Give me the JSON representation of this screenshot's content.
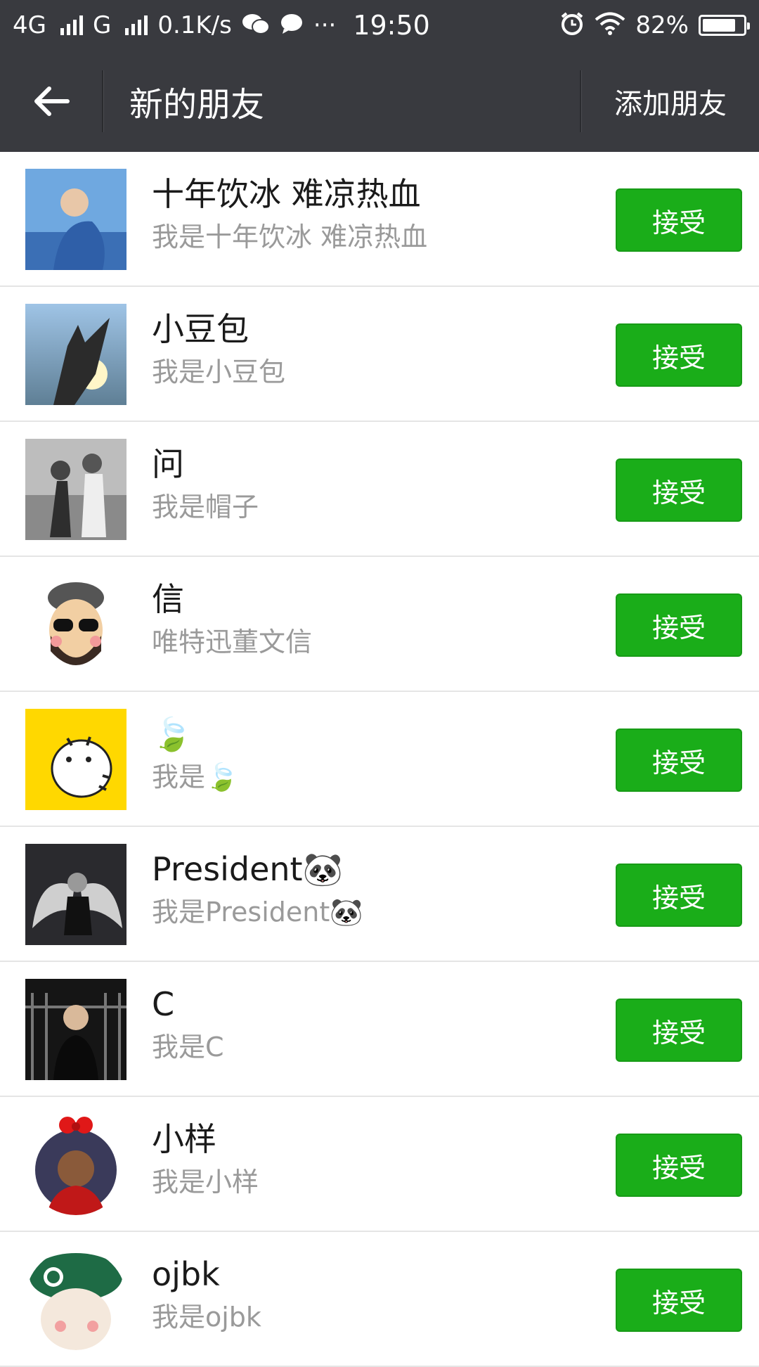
{
  "status_bar": {
    "network_1": "4G",
    "network_2": "G",
    "speed": "0.1K/s",
    "extra_icons": "···",
    "time": "19:50",
    "battery": "82%",
    "battery_level": 0.82
  },
  "header": {
    "back_icon": "arrow-left-icon",
    "title": "新的朋友",
    "add_friend_label": "添加朋友"
  },
  "accept_color": "#1aad19",
  "requests": [
    {
      "name": "十年饮冰 难凉热血",
      "message": "我是十年饮冰 难凉热血",
      "accept_label": "接受"
    },
    {
      "name": "小豆包",
      "message": "我是小豆包",
      "accept_label": "接受"
    },
    {
      "name": "问",
      "message": "我是帽子",
      "accept_label": "接受"
    },
    {
      "name": "信",
      "message": "唯特迅董文信",
      "accept_label": "接受"
    },
    {
      "name": "🍃",
      "message": "我是🍃",
      "accept_label": "接受"
    },
    {
      "name": "President🐼",
      "message": "我是President🐼",
      "accept_label": "接受"
    },
    {
      "name": "C",
      "message": "我是C",
      "accept_label": "接受"
    },
    {
      "name": "小样",
      "message": "我是小样",
      "accept_label": "接受"
    },
    {
      "name": "ojbk",
      "message": "我是ojbk",
      "accept_label": "接受"
    }
  ]
}
